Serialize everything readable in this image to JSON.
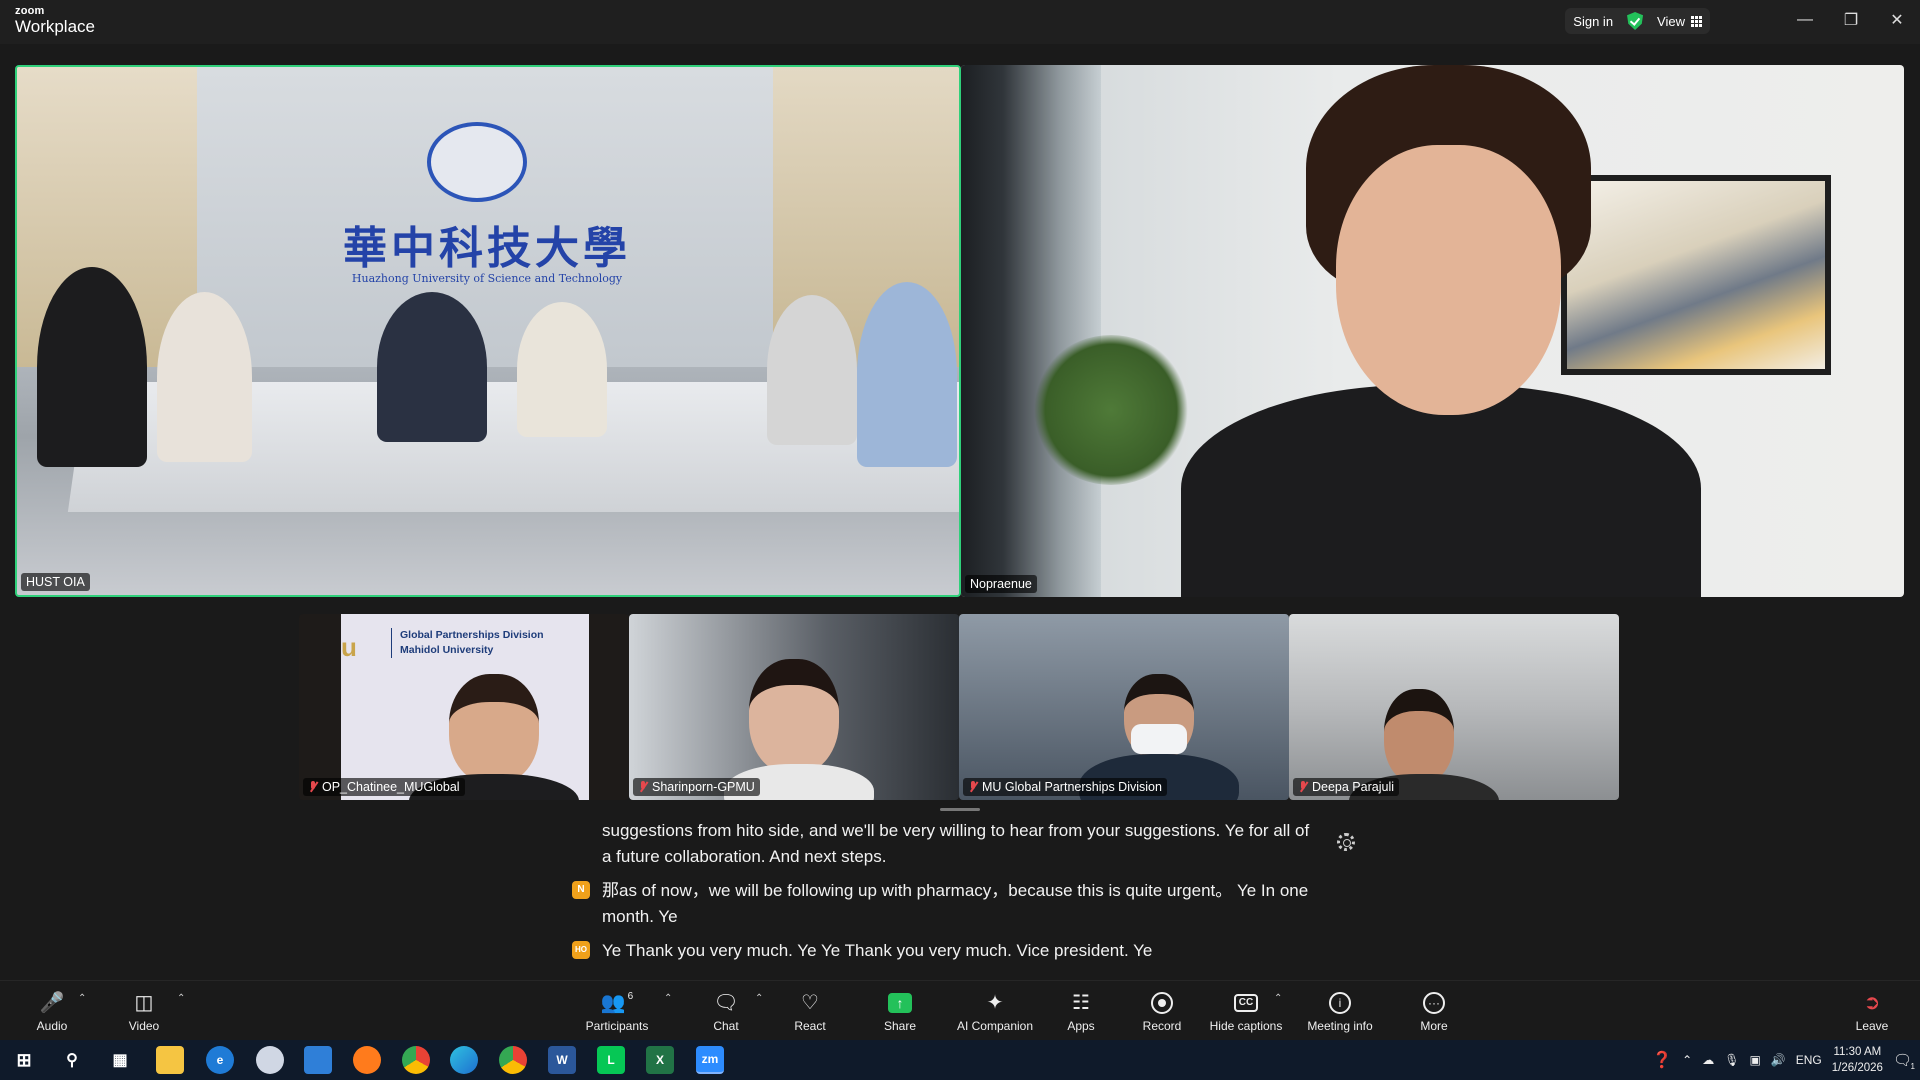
{
  "app": {
    "brand_small": "zoom",
    "brand_large": "Workplace"
  },
  "titlebar": {
    "signin": "Sign in",
    "view": "View"
  },
  "main_tiles": [
    {
      "name": "HUST OIA",
      "muted": false,
      "active_speaker": true
    },
    {
      "name": "Nopraenue",
      "muted": false,
      "active_speaker": false
    }
  ],
  "hust_room": {
    "university_cn": "華中科技大學",
    "university_en": "Huazhong University of Science and Technology"
  },
  "thumbnails": [
    {
      "name": "OP_Chatinee_MUGlobal",
      "muted": true,
      "slide_line1": "Global Partnerships Division",
      "slide_line2": "Mahidol University",
      "slide_letter": "u"
    },
    {
      "name": "Sharinporn-GPMU",
      "muted": true
    },
    {
      "name": "MU Global Partnerships Division",
      "muted": true
    },
    {
      "name": "Deepa Parajuli",
      "muted": true
    }
  ],
  "captions": [
    {
      "avatar": "",
      "text": "suggestions from hito side, and we'll be very willing to hear from your suggestions. Ye for all of a future collaboration. And next steps."
    },
    {
      "avatar": "N",
      "text": "那as of now，we will be following up with pharmacy，because this is quite urgent。 Ye In one month. Ye"
    },
    {
      "avatar": "HO",
      "text": "Ye Thank you very much. Ye Ye Thank you very much. Vice president. Ye"
    }
  ],
  "toolbar": {
    "audio": "Audio",
    "video": "Video",
    "participants": "Participants",
    "participants_count": "6",
    "chat": "Chat",
    "react": "React",
    "share": "Share",
    "ai_companion": "AI Companion",
    "apps": "Apps",
    "record": "Record",
    "hide_captions": "Hide captions",
    "meeting_info": "Meeting info",
    "more": "More",
    "leave": "Leave",
    "cc_glyph": "CC"
  },
  "taskbar": {
    "language": "ENG",
    "time": "11:30 AM",
    "date": "1/26/2026",
    "apps": [
      "file-explorer",
      "edge-legacy",
      "paint",
      "mail",
      "firefox",
      "chrome",
      "edge",
      "chrome-profile",
      "word",
      "line",
      "excel",
      "zoom"
    ],
    "word_letter": "W",
    "excel_letter": "X",
    "zoom_letters": "zm",
    "notification_count": "1"
  },
  "colors": {
    "active_speaker_border": "#2fd07a",
    "share_green": "#23c15a",
    "muted_red": "#e5484d",
    "caption_avatar": "#f0a11b"
  }
}
